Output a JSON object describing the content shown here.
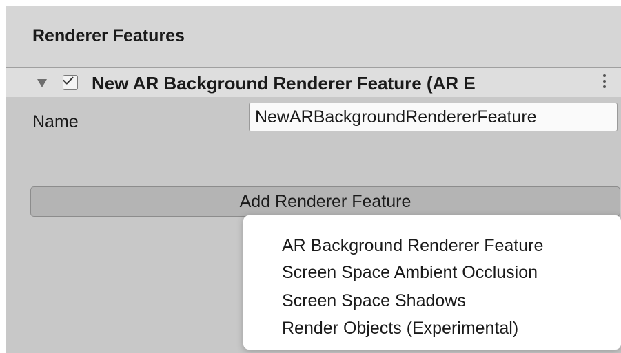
{
  "section": {
    "title": "Renderer Features"
  },
  "feature": {
    "title": "New AR Background Renderer Feature (AR E",
    "enabled": true,
    "name_label": "Name",
    "name_value": "NewARBackgroundRendererFeature"
  },
  "add_button": {
    "label": "Add Renderer Feature"
  },
  "menu": {
    "items": [
      {
        "label": "AR Background Renderer Feature"
      },
      {
        "label": "Screen Space Ambient Occlusion"
      },
      {
        "label": "Screen Space Shadows"
      },
      {
        "label": "Render Objects (Experimental)"
      }
    ]
  },
  "icons": {
    "foldout": "foldout-triangle-icon",
    "checkbox": "checkmark-icon",
    "more": "vertical-ellipsis-icon"
  }
}
